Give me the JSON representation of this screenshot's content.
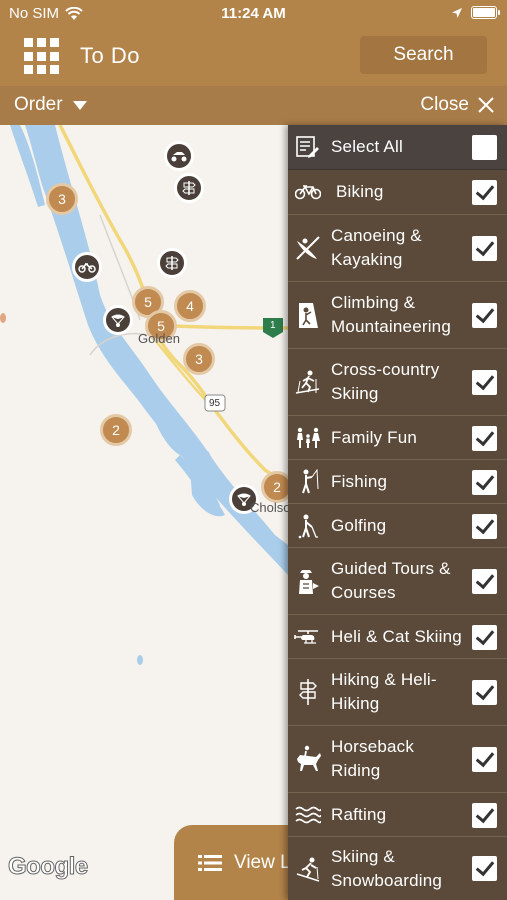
{
  "status": {
    "carrier": "No SIM",
    "time": "11:24 AM"
  },
  "header": {
    "title": "To Do",
    "search_label": "Search"
  },
  "subbar": {
    "order_label": "Order",
    "close_label": "Close"
  },
  "map": {
    "clusters": [
      "3",
      "5",
      "4",
      "5",
      "3",
      "2",
      "2"
    ],
    "labels": {
      "golden": "Golden",
      "road95": "95",
      "road1": "1",
      "cholso": "Cholso"
    },
    "attribution": "Google"
  },
  "view_list_label": "View L",
  "filters": {
    "select_all": {
      "label": "Select All",
      "checked": false,
      "icon": "list-edit-icon"
    },
    "items": [
      {
        "label": "Biking",
        "checked": true,
        "icon": "bicycle-icon"
      },
      {
        "label": "Canoeing &\nKayaking",
        "checked": true,
        "icon": "kayak-icon"
      },
      {
        "label": "Climbing &\nMountaineering",
        "checked": true,
        "icon": "climbing-icon"
      },
      {
        "label": "Cross-country\nSkiing",
        "checked": true,
        "icon": "cross-country-ski-icon"
      },
      {
        "label": "Family Fun",
        "checked": true,
        "icon": "family-icon"
      },
      {
        "label": "Fishing",
        "checked": true,
        "icon": "fishing-icon"
      },
      {
        "label": "Golfing",
        "checked": true,
        "icon": "golf-icon"
      },
      {
        "label": "Guided Tours &\nCourses",
        "checked": true,
        "icon": "guide-icon"
      },
      {
        "label": "Heli & Cat Skiing",
        "checked": true,
        "icon": "helicopter-icon"
      },
      {
        "label": "Hiking & Heli-\nHiking",
        "checked": true,
        "icon": "signpost-icon"
      },
      {
        "label": "Horseback\nRiding",
        "checked": true,
        "icon": "horse-icon"
      },
      {
        "label": "Rafting",
        "checked": true,
        "icon": "waves-icon"
      },
      {
        "label": "Skiing &\nSnowboarding",
        "checked": true,
        "icon": "downhill-ski-icon"
      }
    ]
  },
  "colors": {
    "brand": "#b3844a",
    "panel": "#5b4a3a",
    "select_all_bg": "#4b4340"
  }
}
